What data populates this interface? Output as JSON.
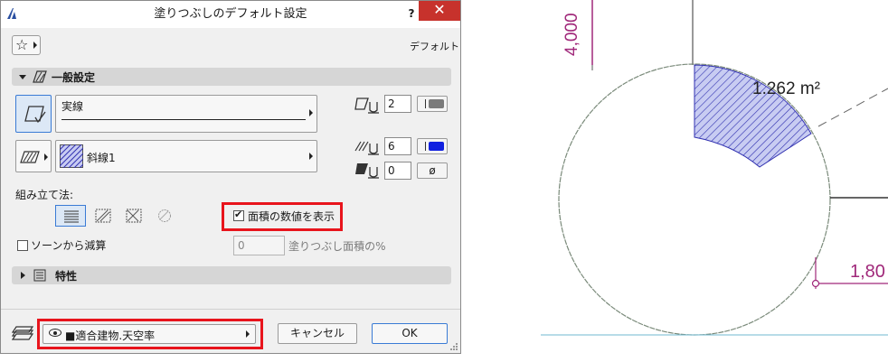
{
  "dialog": {
    "title": "塗りつぶしのデフォルト設定",
    "help_label": "?",
    "close_label": "✕",
    "favorites_label": "☆",
    "default_label": "デフォルト",
    "general_section_label": "一般設定",
    "line_type_label": "実線",
    "line_pen_value": "2",
    "fill_type_label": "斜線1",
    "fill_pen_value": "6",
    "background_pen_value": "0",
    "background_null_symbol": "ø",
    "construction_method_label": "組み立て法:",
    "show_area_label": "面積の数値を表示",
    "show_area_checked": true,
    "subtract_from_zone_label": "ソーンから減算",
    "subtract_from_zone_checked": false,
    "fill_area_percent_value": "0",
    "fill_area_percent_label": "塗りつぶし面積の%",
    "properties_section_label": "特性",
    "layer_label": "■適合建物.天空率",
    "cancel_label": "キャンセル",
    "ok_label": "OK",
    "colors": {
      "line_pen_color": "#7a7a7a",
      "fill_pen_color": "#1020e0",
      "highlight_red": "#e8141c"
    }
  },
  "drawing": {
    "area_label": "1.262 m²",
    "dimension_vertical": "4,000",
    "dimension_horizontal": "1,80",
    "colors": {
      "dimension_color": "#a0287a",
      "hatch_color": "#3030b0",
      "hatch_fill": "#c8ccf2",
      "circle_color": "#7a8a7a",
      "guide_color": "#6fb8d0"
    }
  }
}
